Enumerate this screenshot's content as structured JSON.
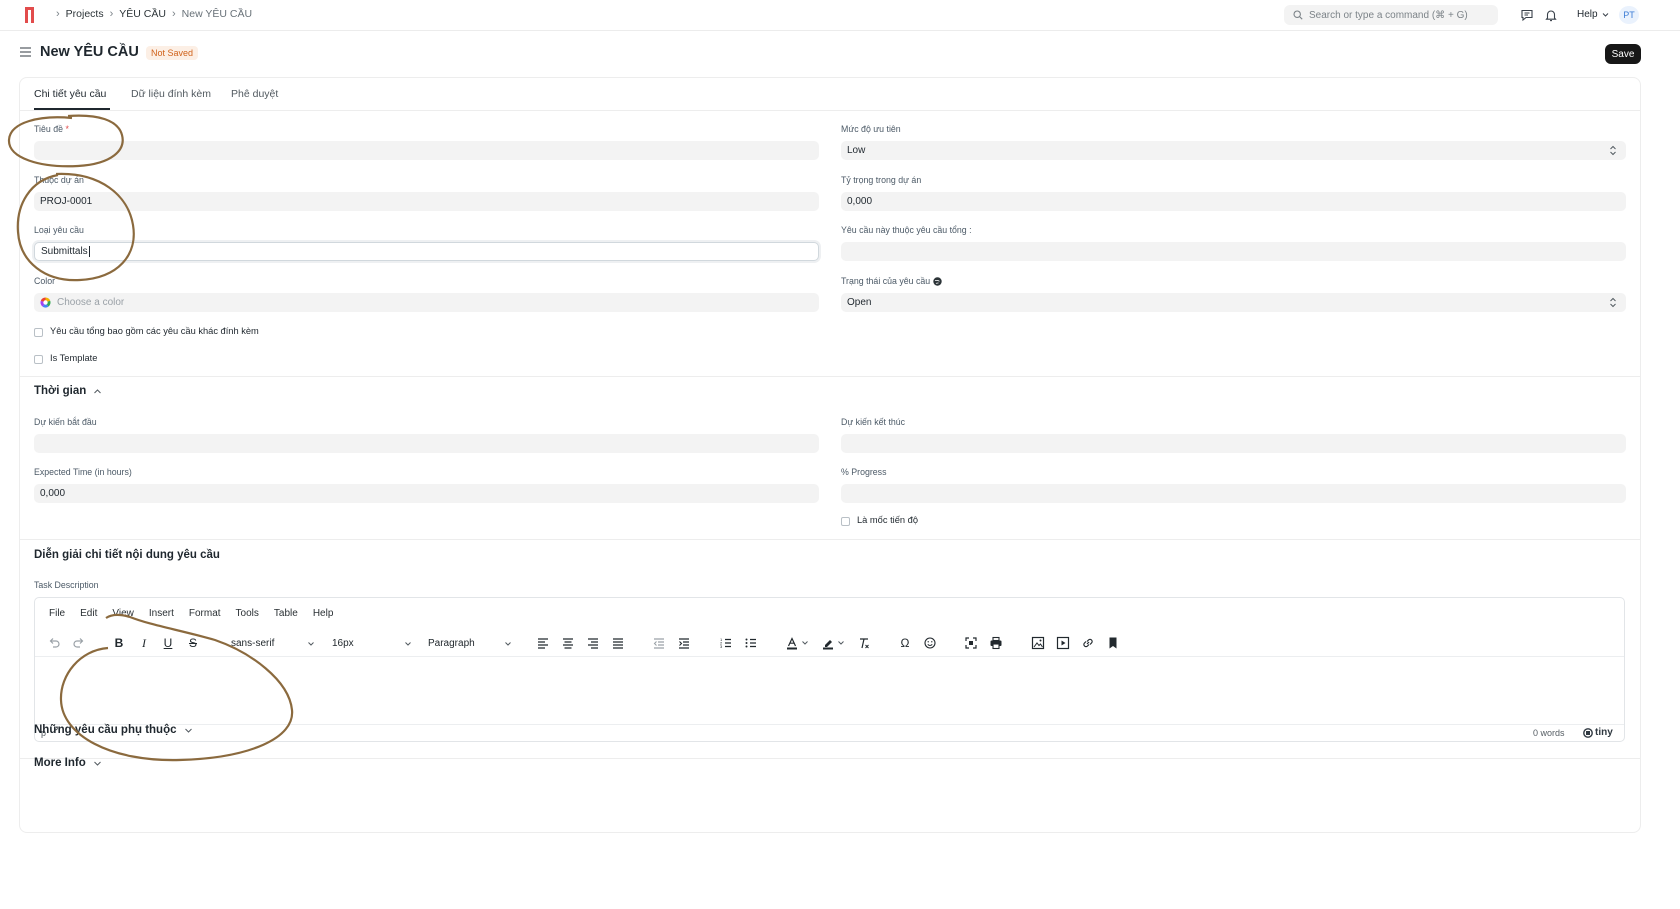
{
  "navbar": {
    "breadcrumbs": [
      "Projects",
      "YÊU CẦU",
      "New YÊU CẦU"
    ],
    "search_placeholder": "Search or type a command (⌘ + G)",
    "help_label": "Help",
    "avatar_initials": "PT"
  },
  "header": {
    "title": "New YÊU CẦU",
    "status_badge": "Not Saved",
    "save_label": "Save"
  },
  "tabs": [
    {
      "label": "Chi tiết yêu cầu",
      "active": true
    },
    {
      "label": "Dữ liệu đính kèm",
      "active": false
    },
    {
      "label": "Phê duyệt",
      "active": false
    }
  ],
  "details": {
    "title_label": "Tiêu đề",
    "required_mark": "*",
    "title_value": "",
    "project_label": "Thuộc dự án",
    "project_value": "PROJ-0001",
    "type_label": "Loại yêu cầu",
    "type_value": "Submittals",
    "color_label": "Color",
    "color_placeholder": "Choose a color",
    "parent_include_label": "Yêu cầu tổng bao gồm các yêu cầu khác đính kèm",
    "is_template_label": "Is Template",
    "priority_label": "Mức độ ưu tiên",
    "priority_value": "Low",
    "weight_label": "Tỷ trọng trong dự án",
    "weight_value": "0,000",
    "parent_label": "Yêu cầu này thuộc yêu cầu tổng :",
    "parent_value": "",
    "status_label": "Trạng thái của yêu cầu",
    "status_value": "Open"
  },
  "time_section": {
    "title": "Thời gian",
    "expected_start_label": "Dự kiến bắt đầu",
    "expected_start_value": "",
    "expected_time_label": "Expected Time (in hours)",
    "expected_time_value": "0,000",
    "expected_end_label": "Dự kiến kết thúc",
    "expected_end_value": "",
    "progress_label": "% Progress",
    "progress_value": "",
    "milestone_label": "Là mốc tiến độ"
  },
  "description_section": {
    "title": "Diễn giải chi tiết nội dung yêu cầu",
    "field_label": "Task Description",
    "menu": [
      "File",
      "Edit",
      "View",
      "Insert",
      "Format",
      "Tools",
      "Table",
      "Help"
    ],
    "font_family": "sans-serif",
    "font_size": "16px",
    "block_format": "Paragraph",
    "status_path": "p",
    "word_count": "0 words",
    "brand": "tiny"
  },
  "dependencies_section": {
    "title": "Những yêu cầu phụ thuộc"
  },
  "more_info_section": {
    "title": "More Info"
  },
  "colors": {
    "annotation": "#8b6a3e",
    "badge_bg": "#fcefe5",
    "badge_text": "#d0621b",
    "logo": "#e24c4c",
    "save_bg": "#171717"
  }
}
